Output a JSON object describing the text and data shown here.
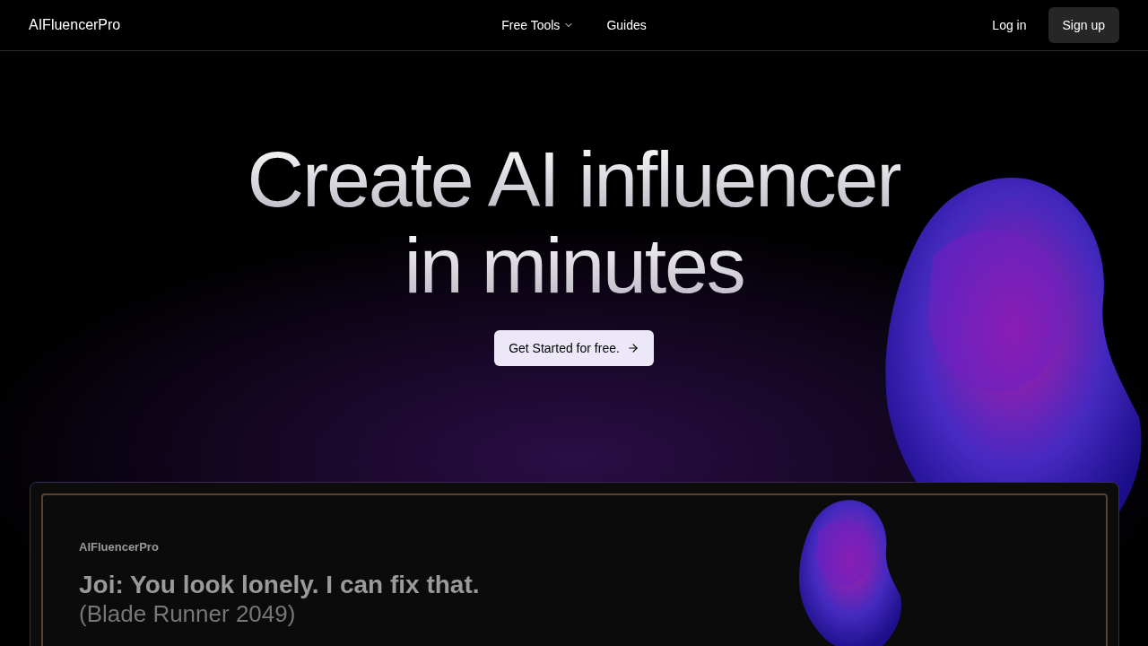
{
  "nav": {
    "brand": "AIFluencerPro",
    "links": [
      {
        "label": "Free Tools",
        "kind": "dropdown"
      },
      {
        "label": "Guides",
        "kind": "link"
      }
    ],
    "login": "Log in",
    "signup": "Sign up"
  },
  "hero": {
    "title_lines": [
      "Create AI influencer",
      "in minutes"
    ],
    "cta": "Get Started for free."
  },
  "preview": {
    "brand": "AIFluencerPro",
    "quote": "Joi: You look lonely. I can fix that.",
    "source": "(Blade Runner 2049)"
  }
}
